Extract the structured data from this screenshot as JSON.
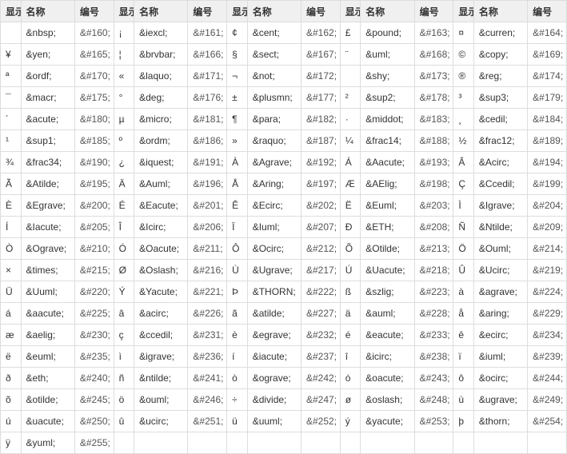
{
  "headers": [
    "显示",
    "名称",
    "编号",
    "显示",
    "名称",
    "编号",
    "显示",
    "名称",
    "编号",
    "显示",
    "名称",
    "编号",
    "显示",
    "名称",
    "编号"
  ],
  "entities": [
    {
      "g": " ",
      "n": "&nbsp;",
      "c": "&#160;"
    },
    {
      "g": "¡",
      "n": "&iexcl;",
      "c": "&#161;"
    },
    {
      "g": "¢",
      "n": "&cent;",
      "c": "&#162;"
    },
    {
      "g": "£",
      "n": "&pound;",
      "c": "&#163;"
    },
    {
      "g": "¤",
      "n": "&curren;",
      "c": "&#164;"
    },
    {
      "g": "¥",
      "n": "&yen;",
      "c": "&#165;"
    },
    {
      "g": "¦",
      "n": "&brvbar;",
      "c": "&#166;"
    },
    {
      "g": "§",
      "n": "&sect;",
      "c": "&#167;"
    },
    {
      "g": "¨",
      "n": "&uml;",
      "c": "&#168;"
    },
    {
      "g": "©",
      "n": "&copy;",
      "c": "&#169;"
    },
    {
      "g": "ª",
      "n": "&ordf;",
      "c": "&#170;"
    },
    {
      "g": "«",
      "n": "&laquo;",
      "c": "&#171;"
    },
    {
      "g": "¬",
      "n": "&not;",
      "c": "&#172;"
    },
    {
      "g": "­",
      "n": "&shy;",
      "c": "&#173;"
    },
    {
      "g": "®",
      "n": "&reg;",
      "c": "&#174;"
    },
    {
      "g": "¯",
      "n": "&macr;",
      "c": "&#175;"
    },
    {
      "g": "°",
      "n": "&deg;",
      "c": "&#176;"
    },
    {
      "g": "±",
      "n": "&plusmn;",
      "c": "&#177;"
    },
    {
      "g": "²",
      "n": "&sup2;",
      "c": "&#178;"
    },
    {
      "g": "³",
      "n": "&sup3;",
      "c": "&#179;"
    },
    {
      "g": "´",
      "n": "&acute;",
      "c": "&#180;"
    },
    {
      "g": "µ",
      "n": "&micro;",
      "c": "&#181;"
    },
    {
      "g": "¶",
      "n": "&para;",
      "c": "&#182;"
    },
    {
      "g": "·",
      "n": "&middot;",
      "c": "&#183;"
    },
    {
      "g": "¸",
      "n": "&cedil;",
      "c": "&#184;"
    },
    {
      "g": "¹",
      "n": "&sup1;",
      "c": "&#185;"
    },
    {
      "g": "º",
      "n": "&ordm;",
      "c": "&#186;"
    },
    {
      "g": "»",
      "n": "&raquo;",
      "c": "&#187;"
    },
    {
      "g": "¼",
      "n": "&frac14;",
      "c": "&#188;"
    },
    {
      "g": "½",
      "n": "&frac12;",
      "c": "&#189;"
    },
    {
      "g": "¾",
      "n": "&frac34;",
      "c": "&#190;"
    },
    {
      "g": "¿",
      "n": "&iquest;",
      "c": "&#191;"
    },
    {
      "g": "À",
      "n": "&Agrave;",
      "c": "&#192;"
    },
    {
      "g": "Á",
      "n": "&Aacute;",
      "c": "&#193;"
    },
    {
      "g": "Â",
      "n": "&Acirc;",
      "c": "&#194;"
    },
    {
      "g": "Ã",
      "n": "&Atilde;",
      "c": "&#195;"
    },
    {
      "g": "Ä",
      "n": "&Auml;",
      "c": "&#196;"
    },
    {
      "g": "Å",
      "n": "&Aring;",
      "c": "&#197;"
    },
    {
      "g": "Æ",
      "n": "&AElig;",
      "c": "&#198;"
    },
    {
      "g": "Ç",
      "n": "&Ccedil;",
      "c": "&#199;"
    },
    {
      "g": "È",
      "n": "&Egrave;",
      "c": "&#200;"
    },
    {
      "g": "É",
      "n": "&Eacute;",
      "c": "&#201;"
    },
    {
      "g": "Ê",
      "n": "&Ecirc;",
      "c": "&#202;"
    },
    {
      "g": "Ë",
      "n": "&Euml;",
      "c": "&#203;"
    },
    {
      "g": "Ì",
      "n": "&Igrave;",
      "c": "&#204;"
    },
    {
      "g": "Í",
      "n": "&Iacute;",
      "c": "&#205;"
    },
    {
      "g": "Î",
      "n": "&Icirc;",
      "c": "&#206;"
    },
    {
      "g": "Ï",
      "n": "&Iuml;",
      "c": "&#207;"
    },
    {
      "g": "Ð",
      "n": "&ETH;",
      "c": "&#208;"
    },
    {
      "g": "Ñ",
      "n": "&Ntilde;",
      "c": "&#209;"
    },
    {
      "g": "Ò",
      "n": "&Ograve;",
      "c": "&#210;"
    },
    {
      "g": "Ó",
      "n": "&Oacute;",
      "c": "&#211;"
    },
    {
      "g": "Ô",
      "n": "&Ocirc;",
      "c": "&#212;"
    },
    {
      "g": "Õ",
      "n": "&Otilde;",
      "c": "&#213;"
    },
    {
      "g": "Ö",
      "n": "&Ouml;",
      "c": "&#214;"
    },
    {
      "g": "×",
      "n": "&times;",
      "c": "&#215;"
    },
    {
      "g": "Ø",
      "n": "&Oslash;",
      "c": "&#216;"
    },
    {
      "g": "Ù",
      "n": "&Ugrave;",
      "c": "&#217;"
    },
    {
      "g": "Ú",
      "n": "&Uacute;",
      "c": "&#218;"
    },
    {
      "g": "Û",
      "n": "&Ucirc;",
      "c": "&#219;"
    },
    {
      "g": "Ü",
      "n": "&Uuml;",
      "c": "&#220;"
    },
    {
      "g": "Ý",
      "n": "&Yacute;",
      "c": "&#221;"
    },
    {
      "g": "Þ",
      "n": "&THORN;",
      "c": "&#222;"
    },
    {
      "g": "ß",
      "n": "&szlig;",
      "c": "&#223;"
    },
    {
      "g": "à",
      "n": "&agrave;",
      "c": "&#224;"
    },
    {
      "g": "á",
      "n": "&aacute;",
      "c": "&#225;"
    },
    {
      "g": "â",
      "n": "&acirc;",
      "c": "&#226;"
    },
    {
      "g": "ã",
      "n": "&atilde;",
      "c": "&#227;"
    },
    {
      "g": "ä",
      "n": "&auml;",
      "c": "&#228;"
    },
    {
      "g": "å",
      "n": "&aring;",
      "c": "&#229;"
    },
    {
      "g": "æ",
      "n": "&aelig;",
      "c": "&#230;"
    },
    {
      "g": "ç",
      "n": "&ccedil;",
      "c": "&#231;"
    },
    {
      "g": "è",
      "n": "&egrave;",
      "c": "&#232;"
    },
    {
      "g": "é",
      "n": "&eacute;",
      "c": "&#233;"
    },
    {
      "g": "ê",
      "n": "&ecirc;",
      "c": "&#234;"
    },
    {
      "g": "ë",
      "n": "&euml;",
      "c": "&#235;"
    },
    {
      "g": "ì",
      "n": "&igrave;",
      "c": "&#236;"
    },
    {
      "g": "í",
      "n": "&iacute;",
      "c": "&#237;"
    },
    {
      "g": "î",
      "n": "&icirc;",
      "c": "&#238;"
    },
    {
      "g": "ï",
      "n": "&iuml;",
      "c": "&#239;"
    },
    {
      "g": "ð",
      "n": "&eth;",
      "c": "&#240;"
    },
    {
      "g": "ñ",
      "n": "&ntilde;",
      "c": "&#241;"
    },
    {
      "g": "ò",
      "n": "&ograve;",
      "c": "&#242;"
    },
    {
      "g": "ó",
      "n": "&oacute;",
      "c": "&#243;"
    },
    {
      "g": "ô",
      "n": "&ocirc;",
      "c": "&#244;"
    },
    {
      "g": "õ",
      "n": "&otilde;",
      "c": "&#245;"
    },
    {
      "g": "ö",
      "n": "&ouml;",
      "c": "&#246;"
    },
    {
      "g": "÷",
      "n": "&divide;",
      "c": "&#247;"
    },
    {
      "g": "ø",
      "n": "&oslash;",
      "c": "&#248;"
    },
    {
      "g": "ù",
      "n": "&ugrave;",
      "c": "&#249;"
    },
    {
      "g": "ú",
      "n": "&uacute;",
      "c": "&#250;"
    },
    {
      "g": "û",
      "n": "&ucirc;",
      "c": "&#251;"
    },
    {
      "g": "ü",
      "n": "&uuml;",
      "c": "&#252;"
    },
    {
      "g": "ý",
      "n": "&yacute;",
      "c": "&#253;"
    },
    {
      "g": "þ",
      "n": "&thorn;",
      "c": "&#254;"
    },
    {
      "g": "ÿ",
      "n": "&yuml;",
      "c": "&#255;"
    }
  ]
}
